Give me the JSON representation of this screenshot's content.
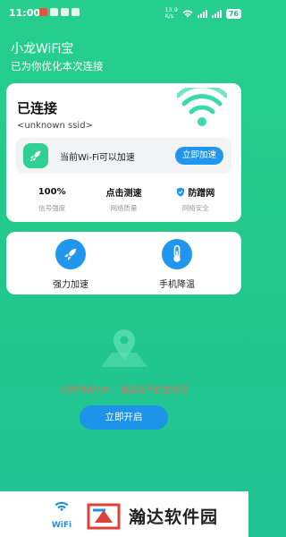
{
  "status_bar": {
    "time": "11:00",
    "network_speed": "13.9\nK/s",
    "battery": "76"
  },
  "header": {
    "app_title": "小龙WiFi宝",
    "subtitle": "已为你优化本次连接"
  },
  "connection": {
    "title": "已连接",
    "ssid": "<unknown ssid>",
    "speed_tip": "当前Wi-Fi可以加速",
    "speed_button": "立即加速"
  },
  "stats": [
    {
      "value": "100%",
      "label": "信号强度"
    },
    {
      "value": "点击测速",
      "label": "网络质量"
    },
    {
      "value": "防蹭网",
      "label": "网络安全"
    }
  ],
  "tools": [
    {
      "label": "强力加速",
      "icon": "rocket-icon"
    },
    {
      "label": "手机降温",
      "icon": "thermometer-icon"
    }
  ],
  "empty_state": {
    "message": "扫描附近WiFi，需要授予位置权限",
    "button": "立即开启"
  },
  "bottom_nav": {
    "items": [
      {
        "label": "WiFi",
        "icon": "wifi-icon",
        "active": true
      }
    ]
  },
  "watermark": {
    "text": "瀚达软件园"
  },
  "colors": {
    "background": "#22c88c",
    "accent_blue": "#2196ef",
    "accent_green": "#2ed193",
    "warning_text": "#f06a5a"
  }
}
